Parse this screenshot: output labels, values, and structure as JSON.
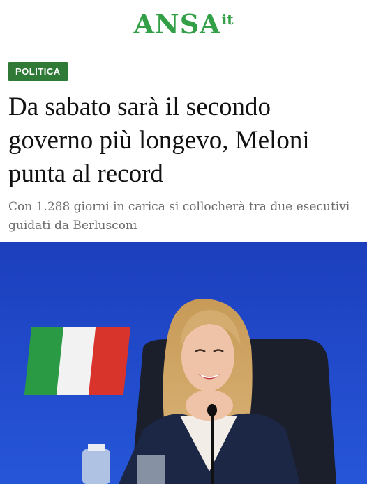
{
  "header": {
    "logo_text": "ANSA",
    "logo_suffix": "it"
  },
  "article": {
    "category": "POLITICA",
    "title": "Da sabato sarà il secondo governo più longevo, Meloni punta al record",
    "subtitle": "Con 1.288 giorni in carica si collocherà tra due esecutivi guidati da Berlusconi"
  },
  "colors": {
    "brand_green": "#33a047",
    "badge_green": "#2f7a36",
    "photo_background_blue": "#1f4fd0"
  }
}
